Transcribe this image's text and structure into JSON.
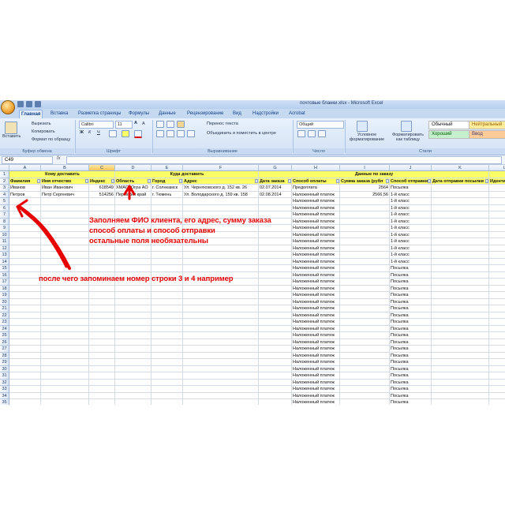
{
  "window": {
    "title": "почтовые бланки.xlsx - Microsoft Excel"
  },
  "tabs": [
    "Главная",
    "Вставка",
    "Разметка страницы",
    "Формулы",
    "Данные",
    "Рецензирование",
    "Вид",
    "Надстройки",
    "Acrobat"
  ],
  "ribbon": {
    "paste_label": "Вставить",
    "cut_label": "Вырезать",
    "copy_label": "Копировать",
    "format_painter_label": "Формат по образцу",
    "clipboard_group": "Буфер обмена",
    "font_name": "Calibri",
    "font_size": "11",
    "font_group": "Шрифт",
    "bold": "Ж",
    "italic": "К",
    "underline": "Ч",
    "wrap_text": "Перенос текста",
    "merge_center": "Объединить и поместить в центре",
    "alignment_group": "Выравнивание",
    "number_format": "Общий",
    "number_group": "Число",
    "conditional_format": "Условное форматирование",
    "format_as_table": "Форматировать как таблицу",
    "style_normal": "Обычный",
    "style_neutral": "Нейтральный",
    "style_good": "Хороший",
    "style_input": "Ввод",
    "styles_group": "Стили"
  },
  "formula_bar": {
    "name_box": "C49",
    "fx": "fx",
    "formula": ""
  },
  "columns": [
    "A",
    "B",
    "C",
    "D",
    "E",
    "F",
    "G",
    "H",
    "I",
    "J",
    "K",
    "L"
  ],
  "selected_column": "C",
  "sheet": {
    "row1": {
      "to_whom": "Кому доставить",
      "where": "Куда доставить",
      "order_data": "Данные по заказу"
    },
    "headers": [
      "Фамилия",
      "Имя отчество",
      "Индекс",
      "Область",
      "Город",
      "Адрес",
      "Дата заказа",
      "Способ оплаты",
      "Сумма заказа (рубл",
      "Способ отправки",
      "Дата отправки посылки",
      "Идентиф"
    ],
    "rows": [
      [
        "Иванов",
        "Иван Иванович",
        "618549",
        "ХМАО Югра АО",
        "г. Солнкамск",
        "Ул. Черняховского д. 152 кв. 26",
        "02.07.2014",
        "Предоплата",
        "2564",
        "Посылка",
        "",
        ""
      ],
      [
        "Петров",
        "Петр Сергеевич",
        "514256",
        "Пермский край",
        "г. Тюмень",
        "Ул. Володарского д. 159 кв. 158",
        "02.08.2014",
        "Наложенный платеж",
        "2566,56",
        "1-й класс",
        "",
        ""
      ]
    ],
    "filler_payment": "Наложенный платеж",
    "filler_methods": [
      "1-й класс",
      "1-й класс",
      "1-й класс",
      "1-й класс",
      "1-й класс",
      "1-й класс",
      "1-й класс",
      "1-й класс",
      "1-й класс",
      "1-й класс",
      "Посылка",
      "Посылка",
      "Посылка",
      "Посылка",
      "Посылка",
      "Посылка",
      "Посылка",
      "Посылка",
      "Посылка",
      "Посылка",
      "Посылка",
      "Посылка",
      "Посылка",
      "Посылка",
      "Посылка",
      "Посылка",
      "Посылка",
      "Посылка",
      "Посылка",
      "Посылка",
      "Посылка"
    ],
    "row_numbers": [
      "1",
      "2",
      "3",
      "4",
      "5",
      "6",
      "7",
      "8",
      "9",
      "10",
      "11",
      "12",
      "13",
      "14",
      "15",
      "16",
      "17",
      "18",
      "19",
      "20",
      "21",
      "22",
      "23",
      "24",
      "25",
      "26",
      "27",
      "28",
      "29",
      "30",
      "31",
      "32",
      "33",
      "34",
      "35"
    ]
  },
  "annotations": {
    "line1": "Заполняем ФИО клиента, его адрес, сумму заказа",
    "line2": "способ оплаты и способ отправки",
    "line3": "остальные поля необязательны",
    "line4": "после чего запоминаем номер строки 3 и 4 например",
    "color": "#e60000"
  }
}
